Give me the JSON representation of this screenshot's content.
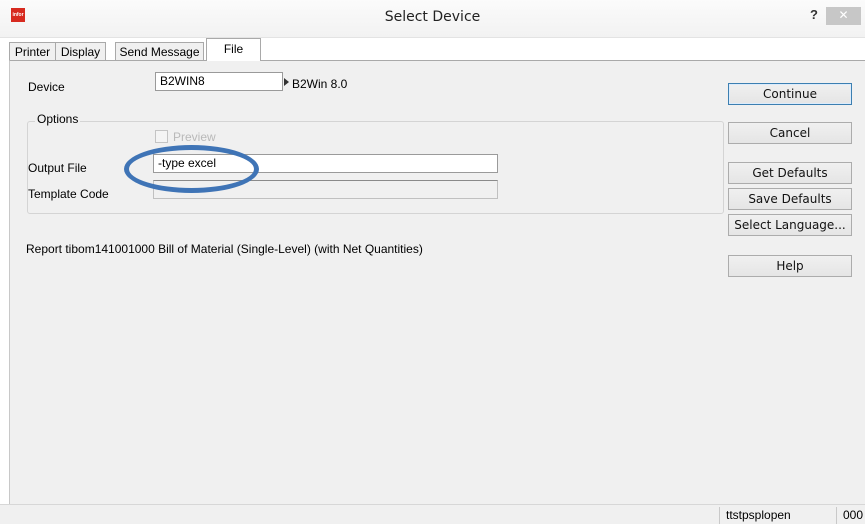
{
  "window": {
    "logo_text": "infor",
    "title": "Select Device",
    "help_label": "?",
    "close_label": "✕"
  },
  "tabs": [
    {
      "label": "Printer",
      "active": false
    },
    {
      "label": "Display",
      "active": false
    },
    {
      "label": "Send Message",
      "active": false
    },
    {
      "label": "File",
      "active": true
    }
  ],
  "form": {
    "device_label": "Device",
    "device_value": "B2WIN8",
    "device_description": "B2Win 8.0",
    "options_group_label": "Options",
    "preview_label": "Preview",
    "preview_checked": false,
    "output_file_label": "Output File",
    "output_file_value": "-type excel",
    "template_code_label": "Template Code",
    "template_code_value": ""
  },
  "report_text": "Report tibom141001000 Bill of Material (Single-Level) (with Net Quantities)",
  "buttons": {
    "continue": "Continue",
    "cancel": "Cancel",
    "get_defaults": "Get Defaults",
    "save_defaults": "Save Defaults",
    "select_language": "Select Language...",
    "help": "Help"
  },
  "statusbar": {
    "session": "ttstpsplopen",
    "code": "000"
  },
  "colors": {
    "highlight_oval": "#3f74b6",
    "logo": "#d72a1f"
  }
}
